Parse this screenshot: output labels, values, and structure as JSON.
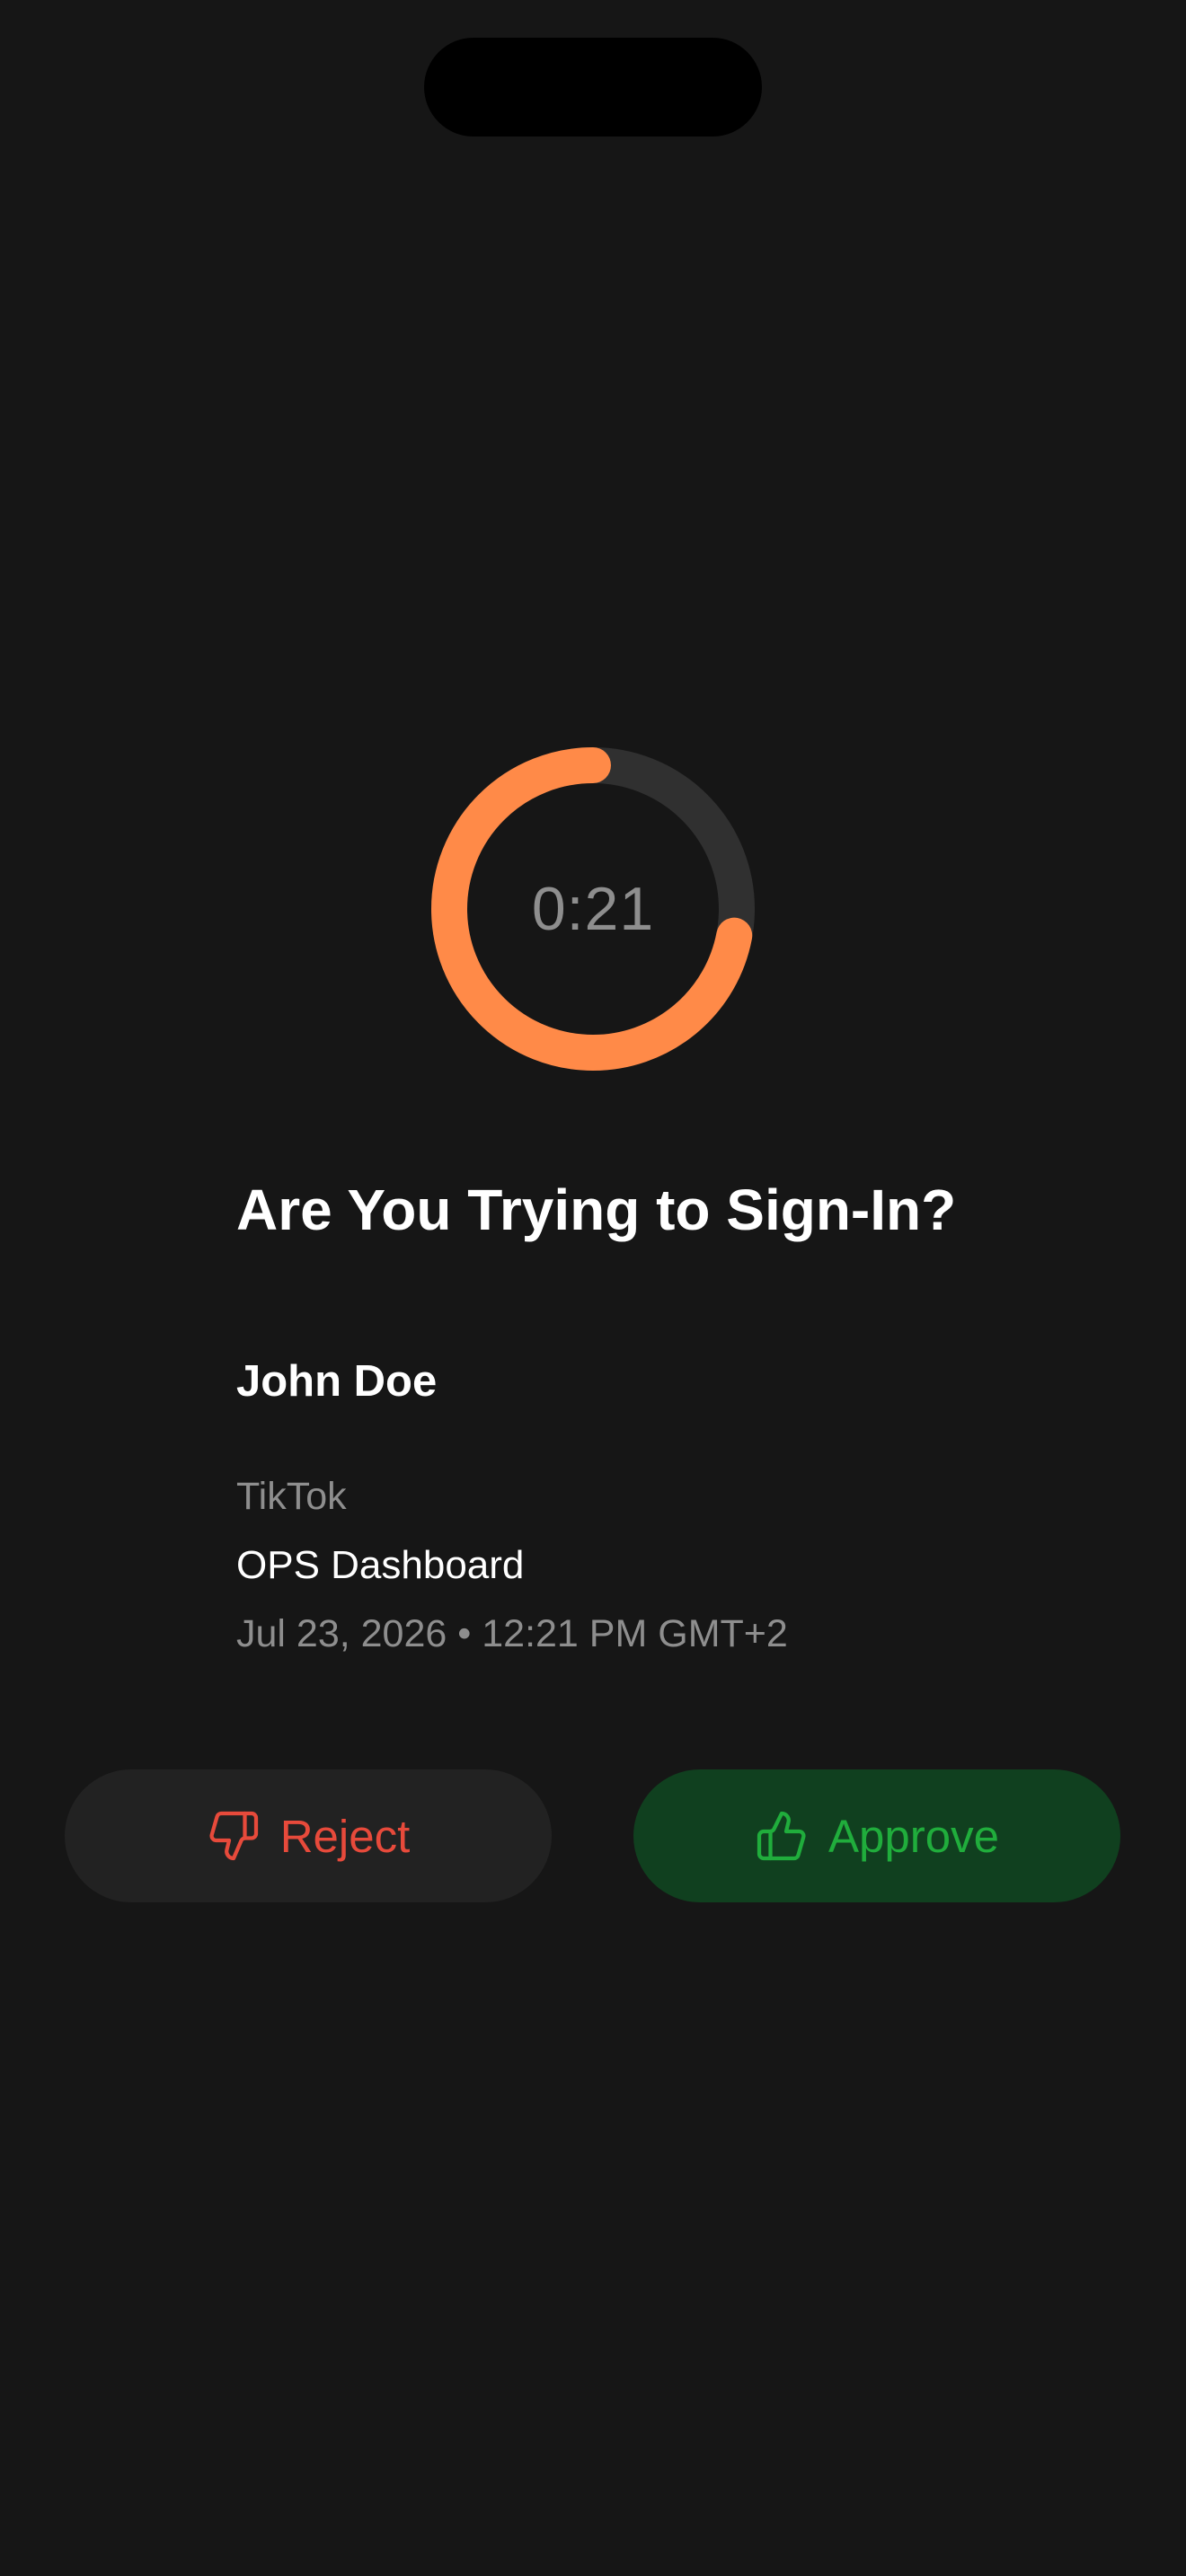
{
  "timer": {
    "remaining": "0:21",
    "progress_fraction": 0.72,
    "accent_color": "#ff8a48",
    "track_color": "#333333"
  },
  "prompt": {
    "title": "Are You Trying to Sign-In?"
  },
  "request": {
    "user_name": "John Doe",
    "app_name": "TikTok",
    "service_name": "OPS Dashboard",
    "timestamp": "Jul 23, 2026 • 12:21 PM GMT+2"
  },
  "actions": {
    "reject_label": "Reject",
    "reject_icon": "thumbs-down-icon",
    "reject_color": "#e74a3b",
    "approve_label": "Approve",
    "approve_icon": "thumbs-up-icon",
    "approve_color": "#20ad3c"
  }
}
